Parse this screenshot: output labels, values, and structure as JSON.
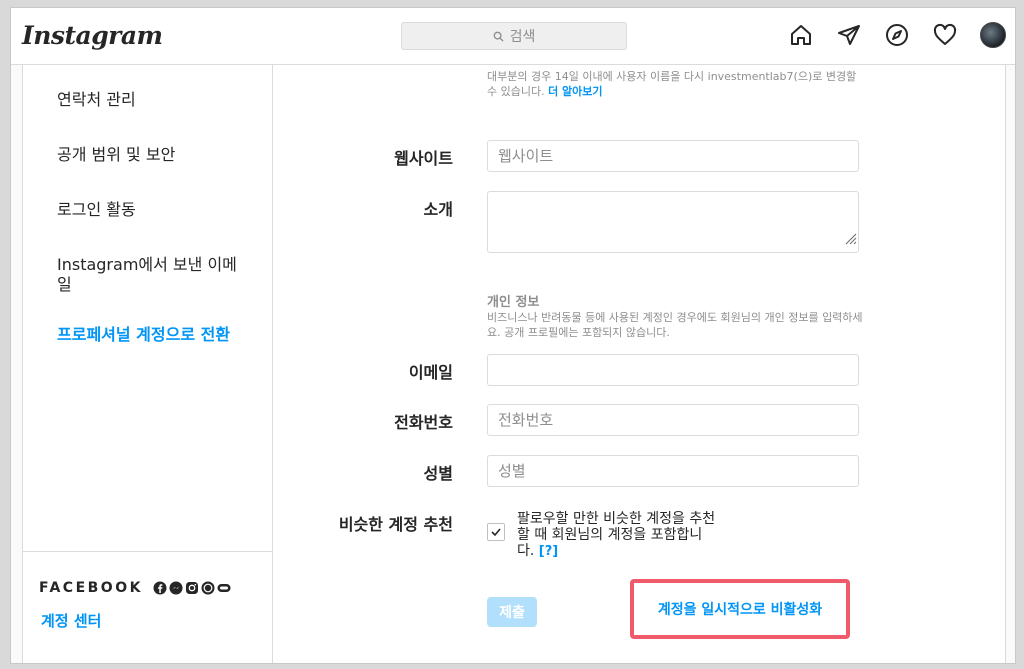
{
  "header": {
    "logo": "Instagram",
    "search_placeholder": "검색",
    "nav_icons": [
      "home-icon",
      "direct-icon",
      "explore-icon",
      "activity-heart-icon",
      "profile-avatar"
    ]
  },
  "sidebar": {
    "items": [
      {
        "label": "연락처 관리"
      },
      {
        "label": "공개 범위 및 보안"
      },
      {
        "label": "로그인 활동"
      },
      {
        "label": "Instagram에서 보낸 이메일"
      },
      {
        "label": "프로페셔널 계정으로 전환"
      }
    ],
    "facebook_label": "FACEBOOK",
    "facebook_icons": [
      "facebook-icon",
      "messenger-icon",
      "instagram-icon",
      "whatsapp-icon",
      "portal-icon"
    ],
    "account_center": "계정 센터"
  },
  "form": {
    "username_hint": "대부분의 경우 14일 이내에 사용자 이름을 다시 investmentlab7(으)로 변경할 수 있습니다.",
    "learn_more": "더 알아보기",
    "website_label": "웹사이트",
    "website_placeholder": "웹사이트",
    "bio_label": "소개",
    "personal_info_title": "개인 정보",
    "personal_info_desc": "비즈니스나 반려동물 등에 사용된 계정인 경우에도 회원님의 개인 정보를 입력하세요. 공개 프로필에는 포함되지 않습니다.",
    "email_label": "이메일",
    "email_value": "",
    "phone_label": "전화번호",
    "phone_placeholder": "전화번호",
    "gender_label": "성별",
    "gender_placeholder": "성별",
    "suggest_label": "비슷한 계정 추천",
    "suggest_text": "팔로우할 만한 비슷한 계정을 추천할 때 회원님의 계정을 포함합니다.",
    "suggest_help": "[?]",
    "suggest_checked": true,
    "submit_label": "제출",
    "deactivate_label": "계정을 일시적으로 비활성화"
  },
  "colors": {
    "accent": "#0095f6",
    "highlight_border": "#ef5b6a",
    "submit_disabled": "#b2dffc"
  }
}
